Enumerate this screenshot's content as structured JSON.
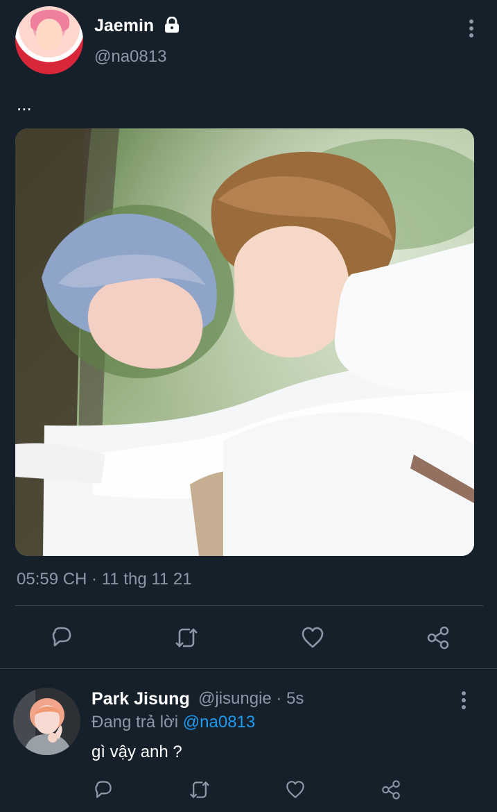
{
  "tweet": {
    "author": {
      "name": "Jaemin",
      "handle": "@na0813",
      "protected_icon": "lock-icon",
      "avatar_description": "profile photo"
    },
    "text": "...",
    "timestamp": "05:59 CH · 11 thg 11 21",
    "actions": [
      {
        "name": "reply",
        "icon": "comment-icon"
      },
      {
        "name": "retweet",
        "icon": "retweet-icon"
      },
      {
        "name": "like",
        "icon": "heart-icon"
      },
      {
        "name": "share",
        "icon": "share-icon"
      }
    ]
  },
  "reply": {
    "author": {
      "name": "Park Jisung",
      "handle": "@jisungie",
      "age": "5s"
    },
    "meta": "@jisungie · 5s",
    "replying_prefix": "Đang trả lời",
    "replying_to": "@na0813",
    "text": "gì vậy anh ?",
    "actions": [
      {
        "name": "reply",
        "icon": "comment-icon"
      },
      {
        "name": "retweet",
        "icon": "retweet-icon"
      },
      {
        "name": "like",
        "icon": "heart-icon"
      },
      {
        "name": "share",
        "icon": "share-icon"
      }
    ]
  },
  "theme": {
    "background": "#15202b",
    "primary_text": "#ffffff",
    "secondary_text": "#8b98a5",
    "accent": "#1d9bf0",
    "divider": "#38444d"
  }
}
